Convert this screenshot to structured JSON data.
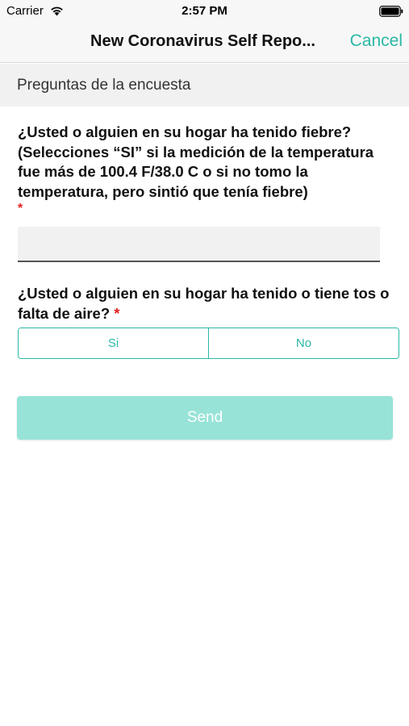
{
  "status_bar": {
    "carrier": "Carrier",
    "time": "2:57 PM"
  },
  "nav": {
    "title": "New Coronavirus Self Repo...",
    "cancel_label": "Cancel",
    "accent_color": "#2bb8a6"
  },
  "section": {
    "header": "Preguntas de la encuesta"
  },
  "questions": [
    {
      "text": "¿Usted o alguien en su hogar ha tenido fiebre? (Selecciones “SI” si la medición de la temperatura fue más de 100.4 F/38.0 C o si no tomo la temperatura, pero sintió que tenía fiebre)",
      "required_mark": "*",
      "input_value": ""
    },
    {
      "text": "¿Usted o alguien en su hogar ha tenido o tiene tos o falta de aire?",
      "required_mark": "*",
      "options": [
        "Si",
        "No"
      ]
    }
  ],
  "send_label": "Send"
}
